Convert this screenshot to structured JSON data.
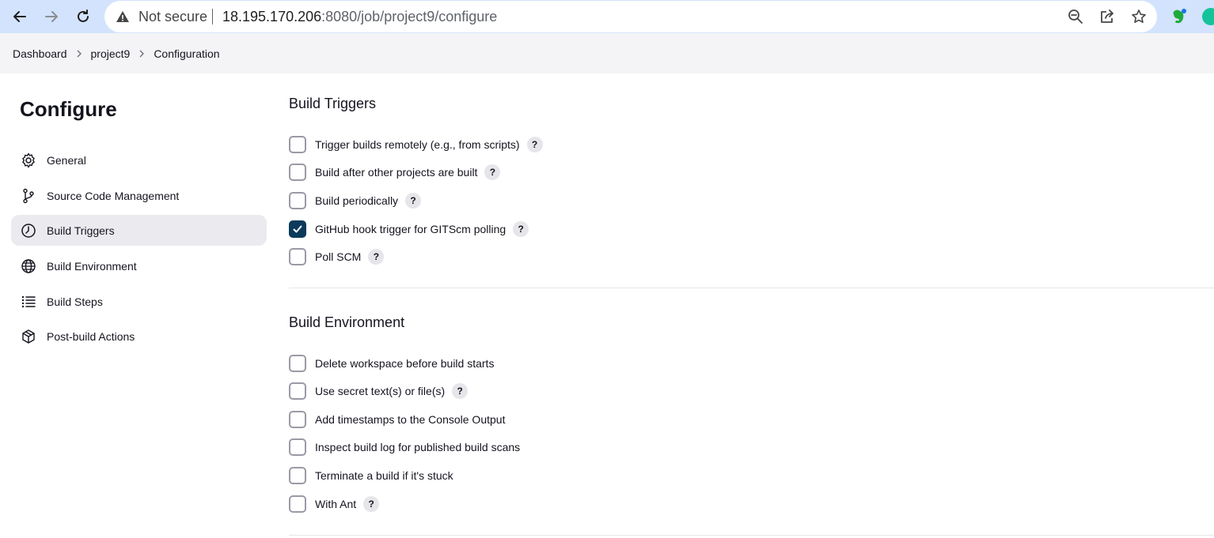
{
  "browser": {
    "security_label": "Not secure",
    "url_host": "18.195.170.206",
    "url_rest": ":8080/job/project9/configure"
  },
  "breadcrumb": {
    "items": [
      "Dashboard",
      "project9",
      "Configuration"
    ]
  },
  "sidebar": {
    "title": "Configure",
    "items": [
      {
        "label": "General",
        "icon": "gear-icon",
        "active": false
      },
      {
        "label": "Source Code Management",
        "icon": "branch-icon",
        "active": false
      },
      {
        "label": "Build Triggers",
        "icon": "timer-icon",
        "active": true
      },
      {
        "label": "Build Environment",
        "icon": "globe-icon",
        "active": false
      },
      {
        "label": "Build Steps",
        "icon": "list-icon",
        "active": false
      },
      {
        "label": "Post-build Actions",
        "icon": "package-icon",
        "active": false
      }
    ]
  },
  "build_triggers": {
    "title": "Build Triggers",
    "options": [
      {
        "label": "Trigger builds remotely (e.g., from scripts)",
        "checked": false,
        "help": "?"
      },
      {
        "label": "Build after other projects are built",
        "checked": false,
        "help": "?"
      },
      {
        "label": "Build periodically",
        "checked": false,
        "help": "?"
      },
      {
        "label": "GitHub hook trigger for GITScm polling",
        "checked": true,
        "help": "?"
      },
      {
        "label": "Poll SCM",
        "checked": false,
        "help": "?"
      }
    ]
  },
  "build_environment": {
    "title": "Build Environment",
    "options": [
      {
        "label": "Delete workspace before build starts",
        "checked": false
      },
      {
        "label": "Use secret text(s) or file(s)",
        "checked": false,
        "help": "?"
      },
      {
        "label": "Add timestamps to the Console Output",
        "checked": false
      },
      {
        "label": "Inspect build log for published build scans",
        "checked": false
      },
      {
        "label": "Terminate a build if it's stuck",
        "checked": false
      },
      {
        "label": "With Ant",
        "checked": false,
        "help": "?"
      }
    ]
  },
  "colors": {
    "browser_bar": "#d3e3fd",
    "checkbox_checked": "#0b3a5b",
    "active_nav_bg": "#ebebef"
  }
}
